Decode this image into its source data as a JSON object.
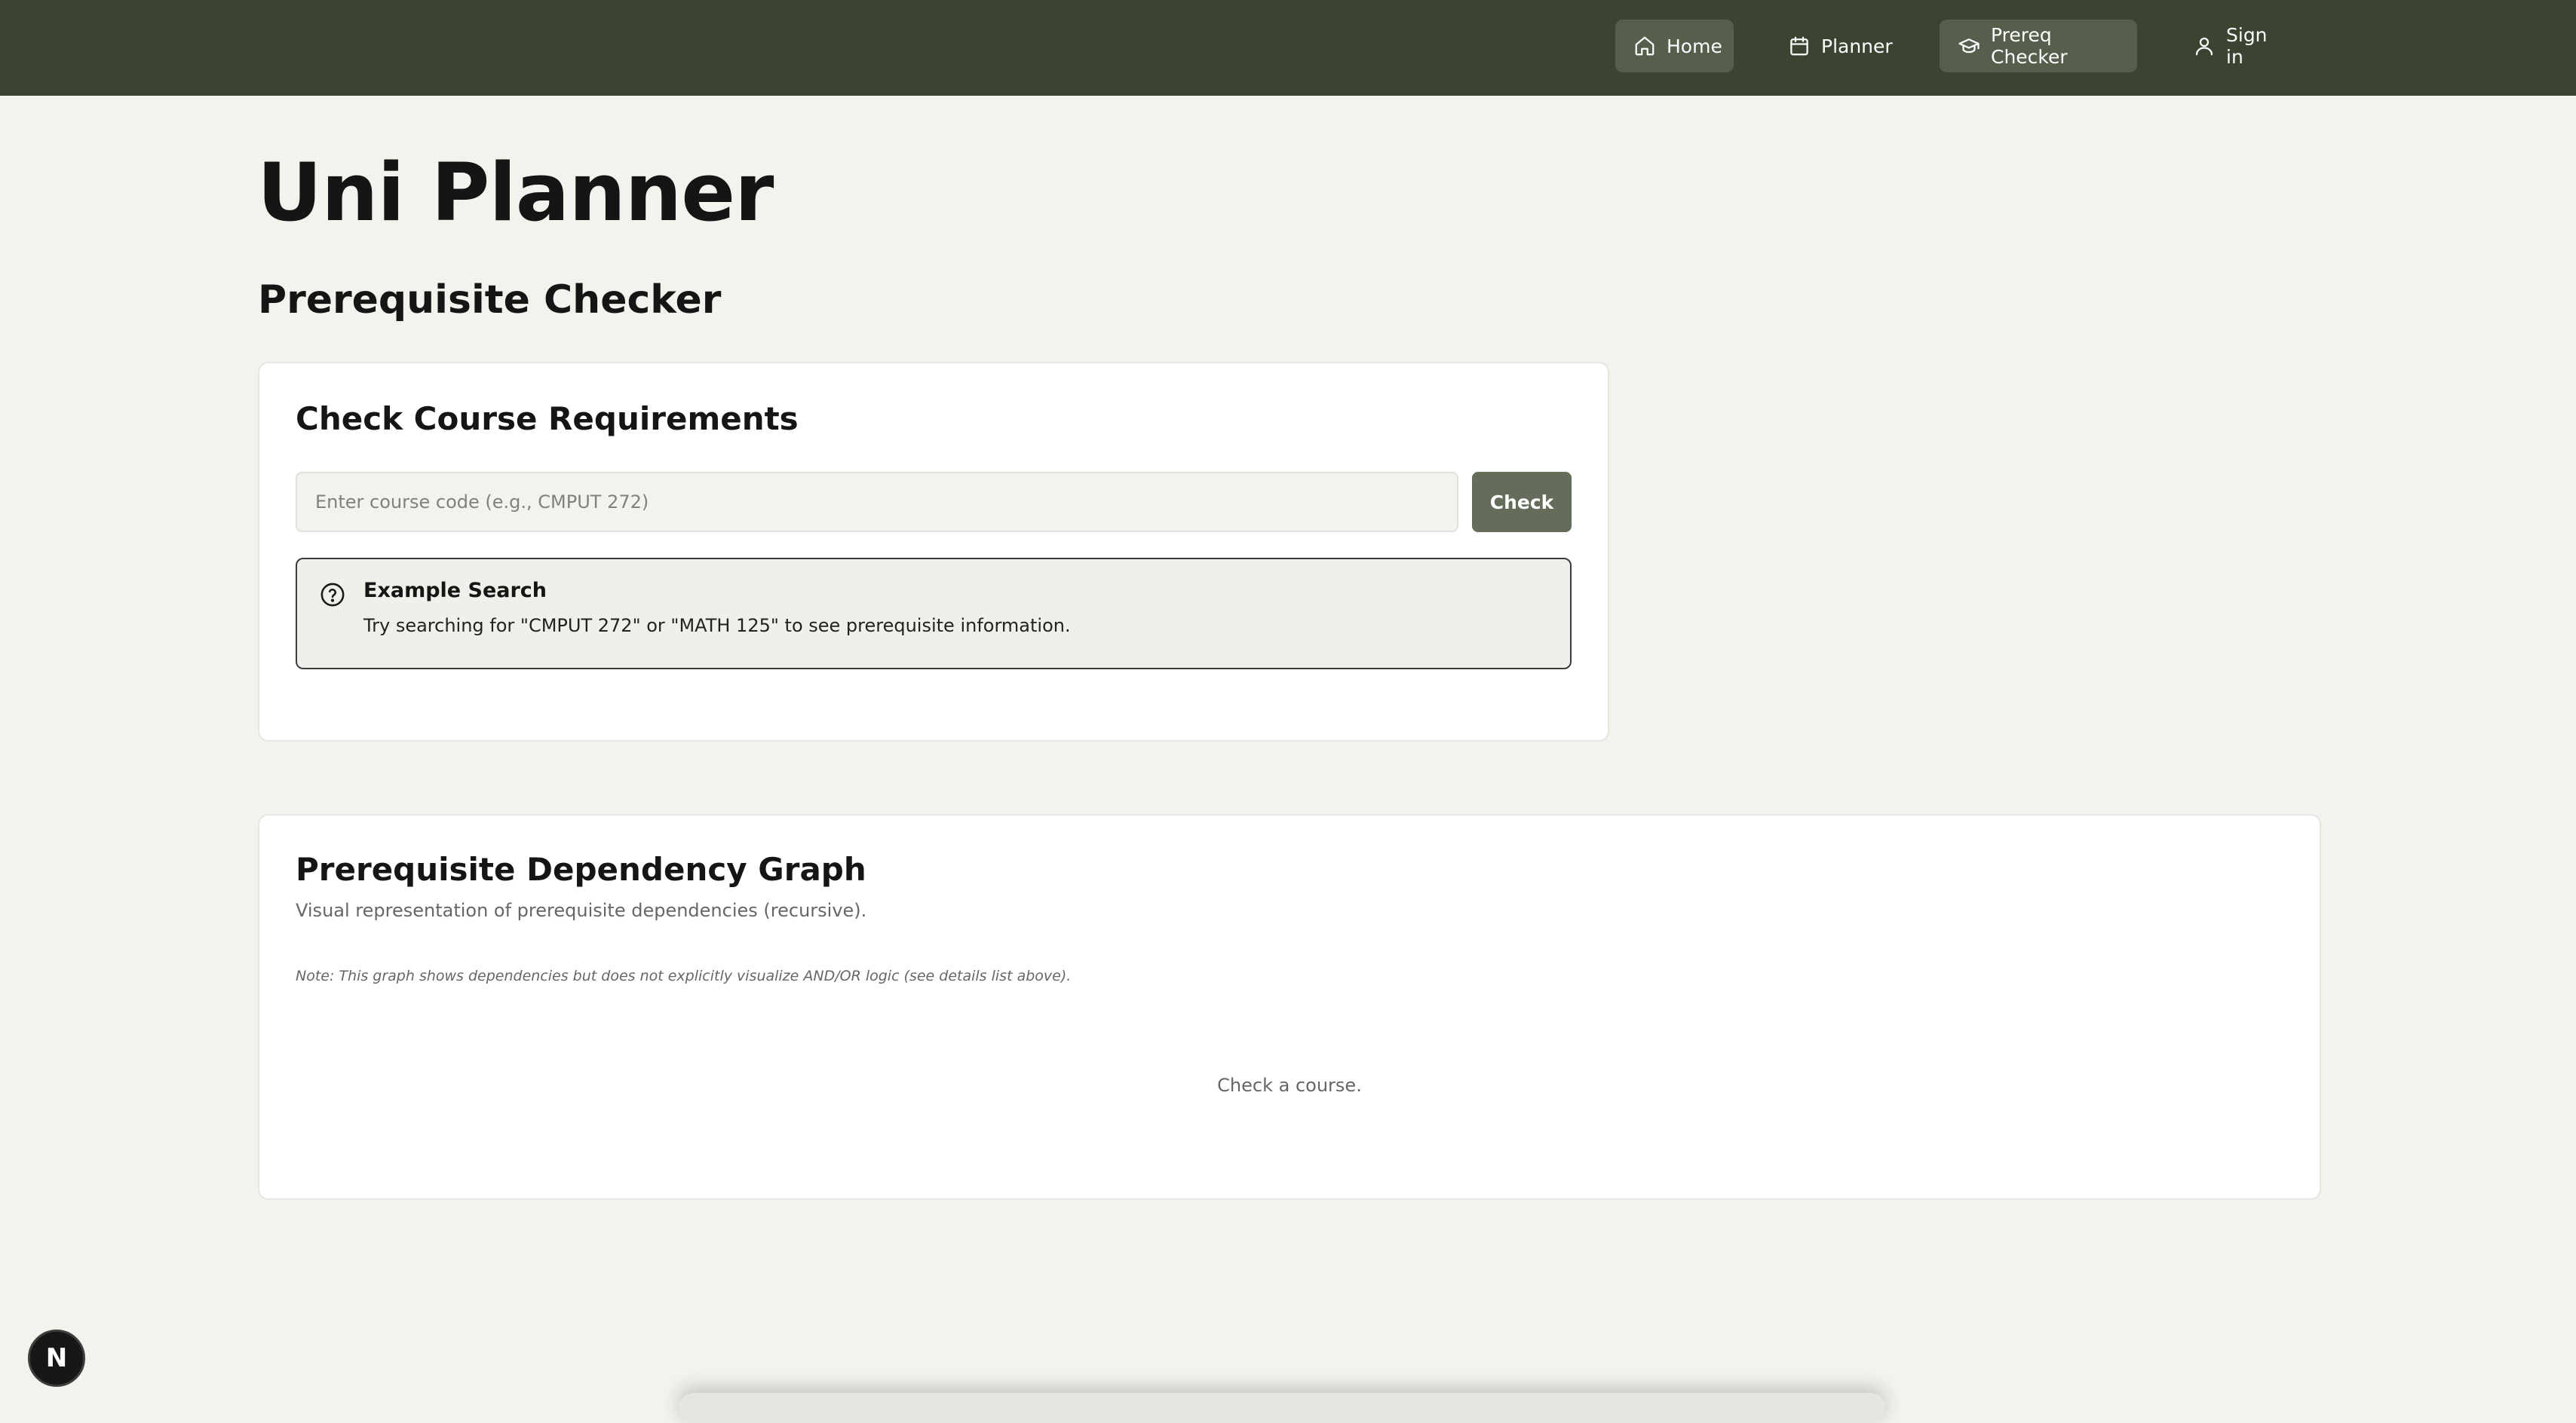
{
  "nav": {
    "items": [
      {
        "label": "Home",
        "icon": "home-icon",
        "active": true
      },
      {
        "label": "Planner",
        "icon": "calendar-icon",
        "active": false
      },
      {
        "label": "Prereq Checker",
        "icon": "graduation-cap-icon",
        "active": true
      },
      {
        "label": "Sign in",
        "icon": "user-icon",
        "active": false
      }
    ],
    "background": "#3a4431",
    "active_background": "#555f4b"
  },
  "header": {
    "app_title": "Uni Planner",
    "page_title": "Prerequisite Checker"
  },
  "check_card": {
    "title": "Check Course Requirements",
    "input_placeholder": "Enter course code (e.g., CMPUT 272)",
    "input_value": "",
    "button_label": "Check",
    "button_color": "#646d5a",
    "example": {
      "icon": "help-circle-icon",
      "title": "Example Search",
      "text": "Try searching for \"CMPUT 272\" or \"MATH 125\" to see prerequisite information."
    }
  },
  "graph_card": {
    "title": "Prerequisite Dependency Graph",
    "subtitle": "Visual representation of prerequisite dependencies (recursive).",
    "note": "Note: This graph shows dependencies but does not explicitly visualize AND/OR logic (see details list above).",
    "empty_text": "Check a course."
  },
  "badge": {
    "letter": "N",
    "icon": "nextjs-icon"
  }
}
